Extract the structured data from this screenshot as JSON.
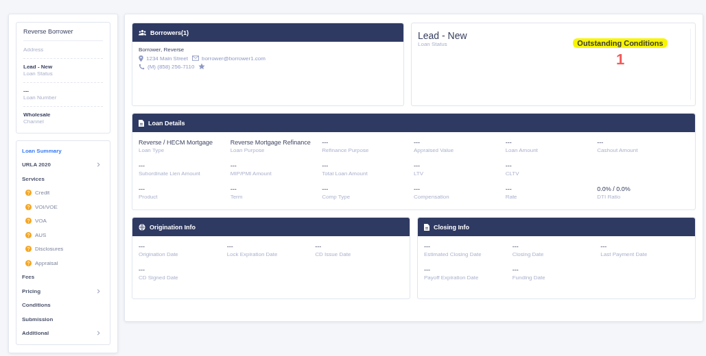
{
  "sidebar": {
    "title": "Reverse Borrower",
    "info": [
      {
        "label": "Address"
      },
      {
        "value": "Lead - New",
        "label": "Loan Status"
      },
      {
        "value": "---",
        "label": "Loan Number"
      },
      {
        "value": "Wholesale",
        "label": "Channel"
      }
    ],
    "nav": [
      {
        "label": "Loan Summary",
        "kind": "section",
        "selected": true,
        "expandable": false
      },
      {
        "label": "URLA 2020",
        "kind": "section",
        "selected": false,
        "expandable": true
      },
      {
        "label": "Services",
        "kind": "section",
        "selected": false,
        "expandable": false
      },
      {
        "label": "Credit",
        "kind": "service",
        "selected": false,
        "expandable": false
      },
      {
        "label": "VOI/VOE",
        "kind": "service",
        "selected": false,
        "expandable": false
      },
      {
        "label": "VOA",
        "kind": "service",
        "selected": false,
        "expandable": false
      },
      {
        "label": "AUS",
        "kind": "service",
        "selected": false,
        "expandable": false
      },
      {
        "label": "Disclosures",
        "kind": "service",
        "selected": false,
        "expandable": false
      },
      {
        "label": "Appraisal",
        "kind": "service",
        "selected": false,
        "expandable": false
      },
      {
        "label": "Fees",
        "kind": "section",
        "selected": false,
        "expandable": false
      },
      {
        "label": "Pricing",
        "kind": "section",
        "selected": false,
        "expandable": true
      },
      {
        "label": "Conditions",
        "kind": "section",
        "selected": false,
        "expandable": false
      },
      {
        "label": "Submission",
        "kind": "section",
        "selected": false,
        "expandable": false
      },
      {
        "label": "Additional",
        "kind": "section",
        "selected": false,
        "expandable": true
      }
    ]
  },
  "borrowers": {
    "title": "Borrowers(1)",
    "name": "Borrower, Reverse",
    "address": "1234 Main Street",
    "email": "borrower@borrower1.com",
    "phone": "(M) (858) 256-7110"
  },
  "status": {
    "value": "Lead - New",
    "label": "Loan Status",
    "conditions_label": "Outstanding Conditions",
    "highlighted": true,
    "conditions_count": "1"
  },
  "loan_details": {
    "title": "Loan Details",
    "rows": [
      [
        {
          "value": "Reverse / HECM Mortgage",
          "label": "Loan Type"
        },
        {
          "value": "Reverse Mortgage Refinance",
          "label": "Loan Purpose"
        },
        {
          "value": "---",
          "label": "Refinance Purpose"
        },
        {
          "value": "---",
          "label": "Appraised Value"
        },
        {
          "value": "---",
          "label": "Loan Amount"
        },
        {
          "value": "---",
          "label": "Cashout Amount"
        }
      ],
      [
        {
          "value": "---",
          "label": "Subordinate Lien Amount"
        },
        {
          "value": "---",
          "label": "MIP/PMI Amount"
        },
        {
          "value": "---",
          "label": "Total Loan Amount"
        },
        {
          "value": "---",
          "label": "LTV"
        },
        {
          "value": "---",
          "label": "CLTV"
        }
      ],
      [
        {
          "value": "---",
          "label": "Product"
        },
        {
          "value": "---",
          "label": "Term"
        },
        {
          "value": "---",
          "label": "Comp Type"
        },
        {
          "value": "---",
          "label": "Compensation"
        },
        {
          "value": "---",
          "label": "Rate"
        },
        {
          "value": "0.0% / 0.0%",
          "label": "DTI Ratio"
        }
      ]
    ]
  },
  "origination_info": {
    "title": "Origination Info",
    "rows": [
      [
        {
          "value": "---",
          "label": "Origination Date"
        },
        {
          "value": "---",
          "label": "Lock Expiration Date"
        },
        {
          "value": "---",
          "label": "CD Issue Date"
        }
      ],
      [
        {
          "value": "---",
          "label": "CD Signed Date"
        }
      ]
    ]
  },
  "closing_info": {
    "title": "Closing Info",
    "rows": [
      [
        {
          "value": "---",
          "label": "Estimated Closing Date"
        },
        {
          "value": "---",
          "label": "Closing Date"
        },
        {
          "value": "---",
          "label": "Last Payment Date"
        }
      ],
      [
        {
          "value": "---",
          "label": "Payoff Expiration Date"
        },
        {
          "value": "---",
          "label": "Funding Date"
        }
      ]
    ]
  }
}
